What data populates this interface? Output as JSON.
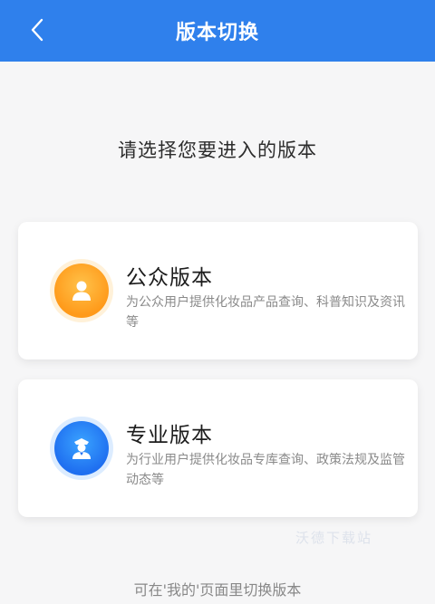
{
  "header": {
    "title": "版本切换",
    "back_icon": "chevron-left-icon"
  },
  "prompt": "请选择您要进入的版本",
  "versions": [
    {
      "title": "公众版本",
      "description": "为公众用户提供化妆品产品查询、科普知识及资讯等",
      "icon": "person-icon",
      "icon_color": "#ffa31f"
    },
    {
      "title": "专业版本",
      "description": "为行业用户提供化妆品专库查询、政策法规及监管动态等",
      "icon": "officer-icon",
      "icon_color": "#2a87f5"
    }
  ],
  "watermark": "沃德下载站",
  "footer_hint": "可在'我的'页面里切换版本",
  "colors": {
    "header_bg": "#2f80ec",
    "page_bg": "#f6f6f7"
  }
}
